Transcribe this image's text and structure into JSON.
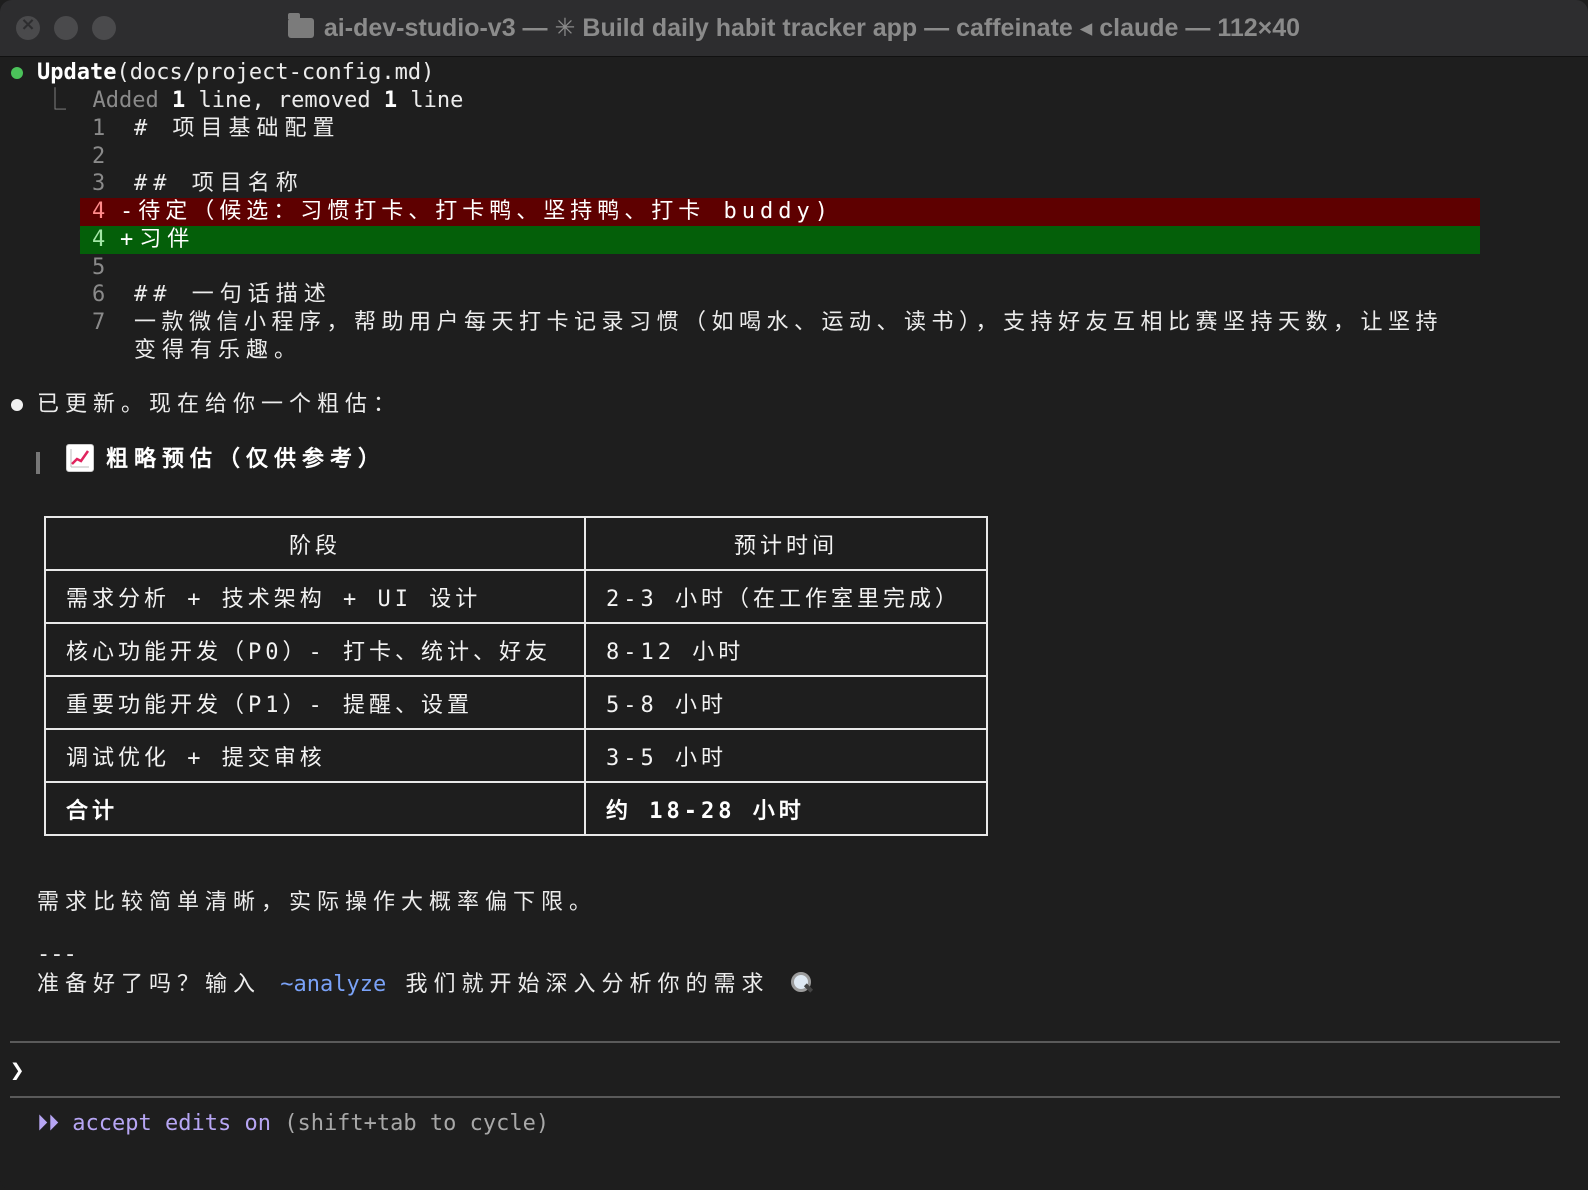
{
  "window": {
    "title": "ai-dev-studio-v3 — ✳ Build daily habit tracker app — caffeinate ◂ claude — 112×40"
  },
  "tool": {
    "name": "Update",
    "arg": "(docs/project-config.md)",
    "summary_prefix": "⎿  Added ",
    "summary_added": "1",
    "summary_mid": " line, removed ",
    "summary_removed": "1",
    "summary_suffix": " line"
  },
  "diff": {
    "lines": [
      {
        "num": "1",
        "text": "# 项目基础配置"
      },
      {
        "num": "2",
        "text": ""
      },
      {
        "num": "3",
        "text": "## 项目名称"
      },
      {
        "num": "4",
        "text": "-待定（候选：习惯打卡、打卡鸭、坚持鸭、打卡 buddy)"
      },
      {
        "num": "4",
        "text": "+习伴"
      },
      {
        "num": "5",
        "text": ""
      },
      {
        "num": "6",
        "text": "## 一句话描述"
      },
      {
        "num": "7",
        "text": "一款微信小程序，帮助用户每天打卡记录习惯（如喝水、运动、读书），支持好友互相比赛坚持天数，让坚持"
      },
      {
        "num": "",
        "text": "变得有乐趣。"
      }
    ]
  },
  "message": {
    "intro": "已更新。现在给你一个粗估：",
    "heading": "粗略预估（仅供参考）",
    "heading_icon": "chart-increasing-icon",
    "table": {
      "headers": [
        "阶段",
        "预计时间"
      ],
      "rows": [
        [
          "需求分析 + 技术架构 + UI 设计",
          "2-3 小时（在工作室里完成）"
        ],
        [
          "核心功能开发（P0）- 打卡、统计、好友",
          "8-12 小时"
        ],
        [
          "重要功能开发（P1）- 提醒、设置",
          "5-8 小时"
        ],
        [
          "调试优化 + 提交审核",
          "3-5 小时"
        ]
      ],
      "total": [
        "合计",
        "约 18-28 小时"
      ]
    },
    "note": "需求比较简单清晰，实际操作大概率偏下限。",
    "separator": "---",
    "cta_prefix": "准备好了吗？输入 ",
    "cta_command": "~analyze",
    "cta_suffix": " 我们就开始深入分析你的需求 "
  },
  "input": {
    "prompt_symbol": "❯",
    "value": ""
  },
  "status": {
    "arrows": "⏵⏵",
    "mode": "accept edits on",
    "hint": "(shift+tab to cycle)"
  }
}
